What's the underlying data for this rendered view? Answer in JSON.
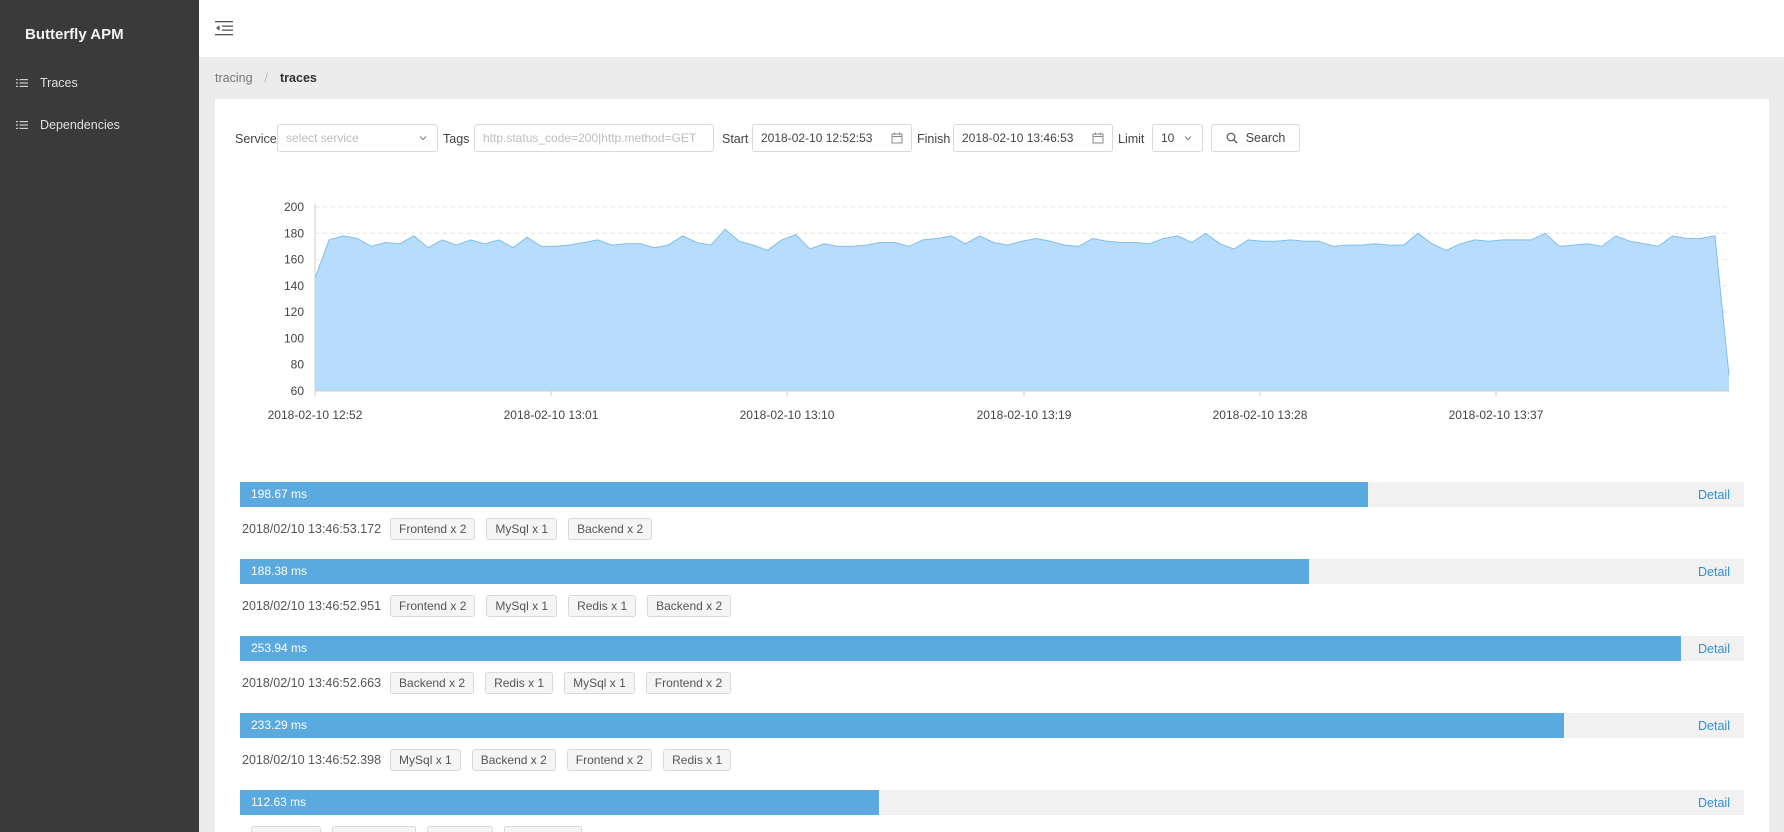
{
  "app": {
    "title": "Butterfly APM"
  },
  "sidebar": {
    "items": [
      {
        "label": "Traces",
        "icon": "list-icon"
      },
      {
        "label": "Dependencies",
        "icon": "list-icon"
      }
    ]
  },
  "breadcrumb": {
    "items": [
      "tracing",
      "traces"
    ],
    "separator": "/"
  },
  "search_form": {
    "service_label": "Service",
    "service_placeholder": "select service",
    "tags_label": "Tags",
    "tags_placeholder": "http.status_code=200|http.method=GET",
    "start_label": "Start",
    "start_value": "2018-02-10 12:52:53",
    "finish_label": "Finish",
    "finish_value": "2018-02-10 13:46:53",
    "limit_label": "Limit",
    "limit_value": "10",
    "search_label": "Search"
  },
  "chart_data": {
    "type": "area",
    "title": "",
    "xlabel": "",
    "ylabel": "",
    "ylim": [
      60,
      200
    ],
    "yticks": [
      60,
      80,
      100,
      120,
      140,
      160,
      180,
      200
    ],
    "xtick_labels": [
      "2018-02-10 12:52",
      "2018-02-10 13:01",
      "2018-02-10 13:10",
      "2018-02-10 13:19",
      "2018-02-10 13:28",
      "2018-02-10 13:37"
    ],
    "grid": "horizontal dashed",
    "color": "#b8dcfb",
    "line_color": "#7fbef0",
    "values": [
      146,
      175,
      178,
      176,
      170,
      173,
      172,
      178,
      169,
      175,
      171,
      175,
      172,
      175,
      169,
      177,
      170,
      170,
      171,
      173,
      175,
      171,
      172,
      172,
      169,
      171,
      178,
      173,
      171,
      183,
      174,
      171,
      167,
      175,
      179,
      168,
      172,
      170,
      170,
      171,
      173,
      173,
      170,
      175,
      176,
      178,
      172,
      178,
      173,
      171,
      174,
      176,
      174,
      171,
      170,
      176,
      174,
      173,
      173,
      172,
      176,
      178,
      173,
      180,
      172,
      168,
      175,
      174,
      174,
      175,
      174,
      174,
      170,
      171,
      171,
      172,
      171,
      171,
      180,
      172,
      167,
      172,
      175,
      174,
      175,
      175,
      175,
      180,
      170,
      171,
      172,
      170,
      178,
      174,
      172,
      170,
      178,
      176,
      176,
      178,
      72
    ]
  },
  "traces": [
    {
      "duration": "198.67 ms",
      "ratio": 0.75,
      "timestamp": "2018/02/10 13:46:53.172",
      "detail": "Detail",
      "tags": [
        "Frontend x 2",
        "MySql x 1",
        "Backend x 2"
      ]
    },
    {
      "duration": "188.38 ms",
      "ratio": 0.711,
      "timestamp": "2018/02/10 13:46:52.951",
      "detail": "Detail",
      "tags": [
        "Frontend x 2",
        "MySql x 1",
        "Redis x 1",
        "Backend x 2"
      ]
    },
    {
      "duration": "253.94 ms",
      "ratio": 0.958,
      "timestamp": "2018/02/10 13:46:52.663",
      "detail": "Detail",
      "tags": [
        "Backend x 2",
        "Redis x 1",
        "MySql x 1",
        "Frontend x 2"
      ]
    },
    {
      "duration": "233.29 ms",
      "ratio": 0.88,
      "timestamp": "2018/02/10 13:46:52.398",
      "detail": "Detail",
      "tags": [
        "MySql x 1",
        "Backend x 2",
        "Frontend x 2",
        "Redis x 1"
      ]
    },
    {
      "duration": "112.63 ms",
      "ratio": 0.425,
      "timestamp": "",
      "detail": "Detail",
      "tags": [
        "",
        "",
        "",
        ""
      ]
    }
  ]
}
